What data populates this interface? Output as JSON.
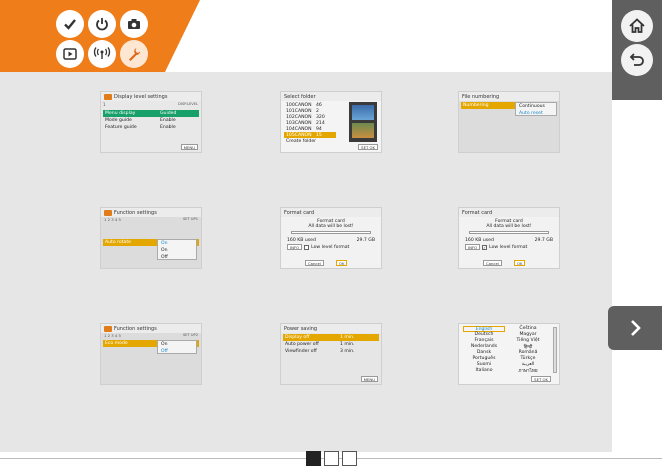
{
  "header": {
    "accent_color": "#ef7d1a",
    "modes": [
      {
        "icon": "checkmark-icon"
      },
      {
        "icon": "power-icon"
      },
      {
        "icon": "camera-icon"
      },
      {
        "icon": "playback-icon"
      },
      {
        "icon": "wireless-icon"
      },
      {
        "icon": "wrench-icon",
        "active": true
      }
    ]
  },
  "right_bar": {
    "home_icon": "home-icon",
    "back_icon": "back-icon"
  },
  "screens": {
    "display_level": {
      "title": "Display level settings",
      "sub_right": "DISP.LEVEL",
      "tab_num": "1",
      "rows": [
        {
          "k": "Menu display",
          "v": "Guided"
        },
        {
          "k": "Mode guide",
          "v": "Enable"
        },
        {
          "k": "Feature guide",
          "v": "Enable"
        }
      ],
      "footer": "MENU"
    },
    "select_folder": {
      "title": "Select folder",
      "folders": [
        {
          "name": "100CANON",
          "count": "46"
        },
        {
          "name": "101CANON",
          "count": "2"
        },
        {
          "name": "102CANON",
          "count": "320"
        },
        {
          "name": "103CANON",
          "count": "214"
        },
        {
          "name": "104CANON",
          "count": "94"
        },
        {
          "name": "105CANON",
          "count": "15"
        }
      ],
      "create": "Create folder",
      "footer": "SET OK"
    },
    "file_numbering": {
      "title": "File numbering",
      "label": "Numbering",
      "options": [
        "Continuous",
        "Auto reset"
      ]
    },
    "function_1": {
      "title": "Function settings",
      "tabs": "1 2 3 4 5",
      "right": "SET UP1",
      "item": "Auto rotate",
      "options": [
        "On",
        "On",
        "Off"
      ]
    },
    "format_1": {
      "title": "Format card",
      "line1": "Format card",
      "line2": "All data will be lost!",
      "used": "160 KB used",
      "size": "29.7 GB",
      "info": "INFO",
      "low": "Low level format",
      "cancel": "Cancel",
      "ok": "OK"
    },
    "format_2": {
      "title": "Format card",
      "line1": "Format card",
      "line2": "All data will be lost!",
      "used": "160 KB used",
      "size": "29.7 GB",
      "info": "INFO",
      "low": "Low level format",
      "cancel": "Cancel",
      "ok": "OK"
    },
    "function_2": {
      "title": "Function settings",
      "tabs": "1 2 3 4 5",
      "right": "SET UP2",
      "item": "Eco mode",
      "options": [
        "On",
        "Off"
      ]
    },
    "power_saving": {
      "title": "Power saving",
      "rows": [
        {
          "k": "Display off",
          "v": "1 min."
        },
        {
          "k": "Auto power off",
          "v": "1 min."
        },
        {
          "k": "Viewfinder off",
          "v": "3 min."
        }
      ],
      "footer": "MENU"
    },
    "language": {
      "left": [
        "English",
        "Deutsch",
        "Français",
        "Nederlands",
        "Dansk",
        "Português",
        "Suomi",
        "Italiano"
      ],
      "right": [
        "Čeština",
        "Magyar",
        "Tiếng Việt",
        "हिन्दी",
        "Română",
        "Türkçe",
        "العربية",
        "ภาษาไทย"
      ],
      "footer": "SET OK"
    }
  },
  "navigation": {
    "next_icon": "chevron-right-icon",
    "pages": [
      "1",
      "2",
      "3"
    ],
    "active_page": 0
  }
}
